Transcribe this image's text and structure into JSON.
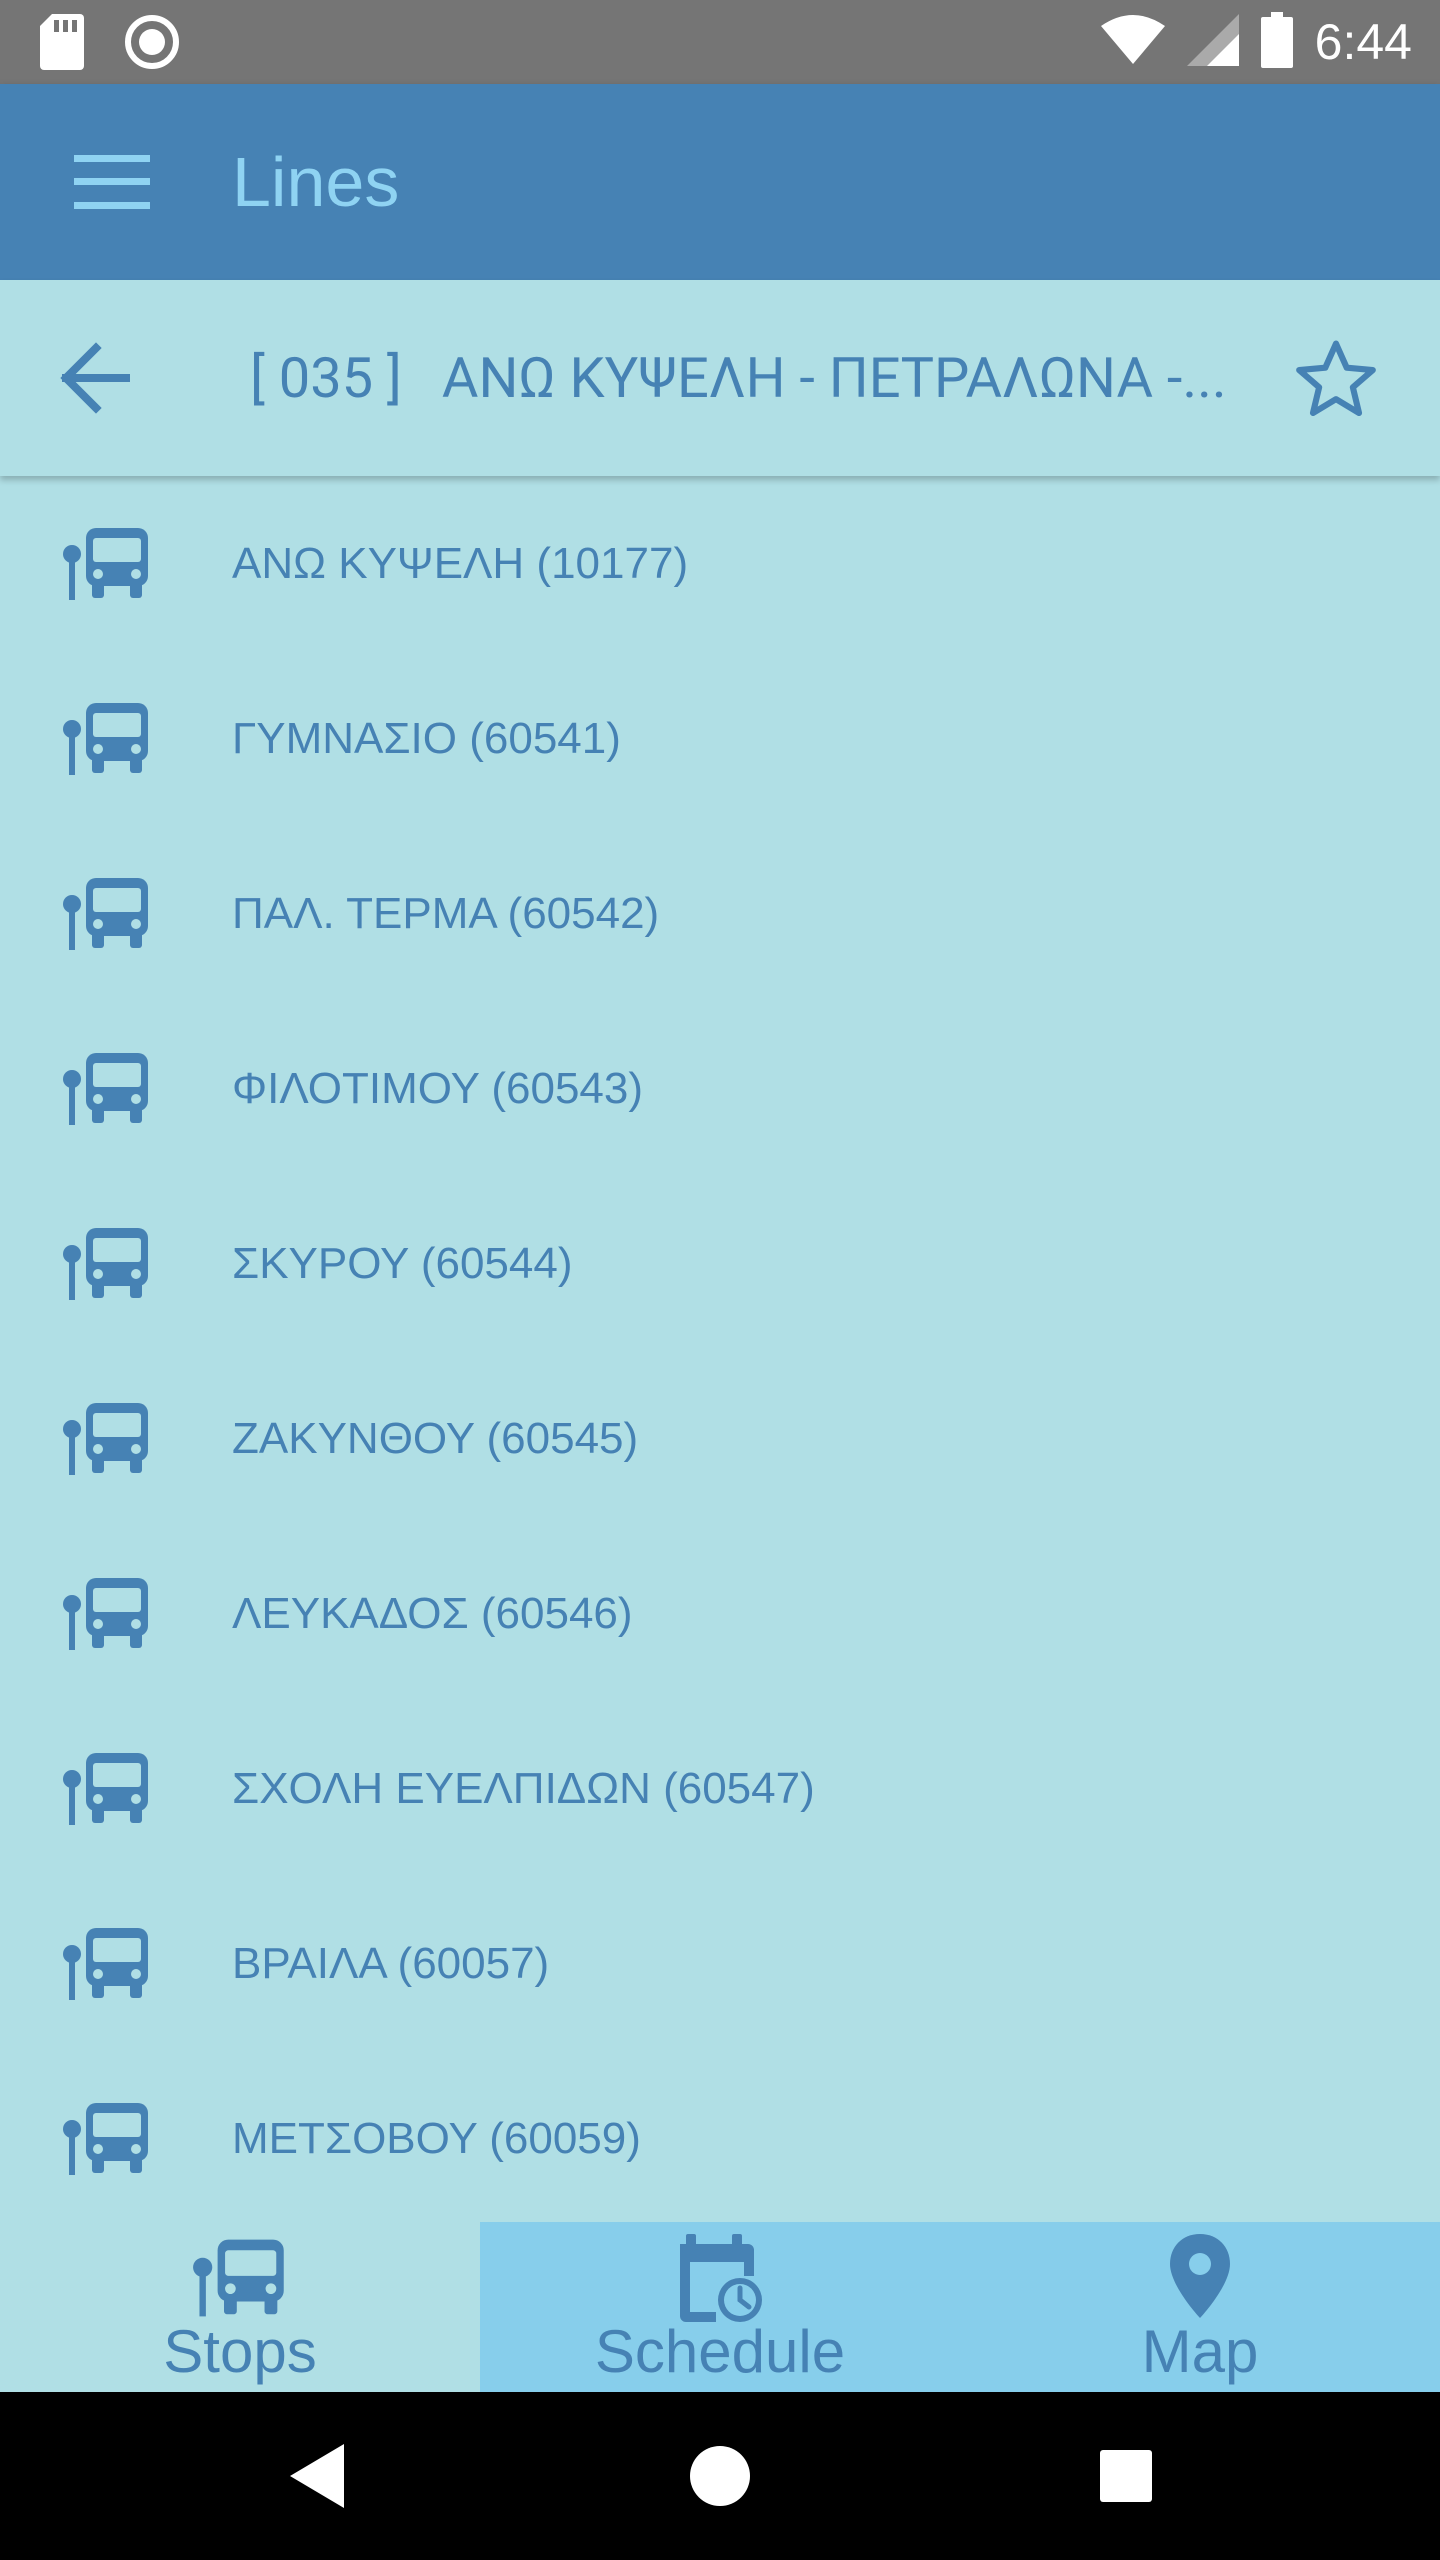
{
  "status_bar": {
    "time": "6:44"
  },
  "app_bar": {
    "title": "Lines"
  },
  "line_header": {
    "code": "[ 035 ]",
    "route": "ΑΝΩ ΚΥΨΕΛΗ - ΠΕΤΡΑΛΩΝΑ -..."
  },
  "stops": [
    {
      "label": "ΑΝΩ ΚΥΨΕΛΗ (10177)"
    },
    {
      "label": "ΓΥΜΝΑΣΙΟ (60541)"
    },
    {
      "label": "ΠΑΛ. ΤΕΡΜΑ (60542)"
    },
    {
      "label": "ΦΙΛΟΤΙΜΟΥ (60543)"
    },
    {
      "label": "ΣΚΥΡΟΥ (60544)"
    },
    {
      "label": "ΖΑΚΥΝΘΟΥ (60545)"
    },
    {
      "label": "ΛΕΥΚΑΔΟΣ (60546)"
    },
    {
      "label": "ΣΧΟΛΗ ΕΥΕΛΠΙΔΩΝ (60547)"
    },
    {
      "label": "ΒΡΑΙΛΑ (60057)"
    },
    {
      "label": "ΜΕΤΣΟΒΟΥ (60059)"
    }
  ],
  "bottom_nav": {
    "stops": "Stops",
    "schedule": "Schedule",
    "map": "Map",
    "active": "stops"
  },
  "colors": {
    "app_bar": "#4682b4",
    "title": "#8fd3f2",
    "accent": "#4682b4",
    "background": "#b0dfe5",
    "inactive_tab": "#87ceeb"
  }
}
